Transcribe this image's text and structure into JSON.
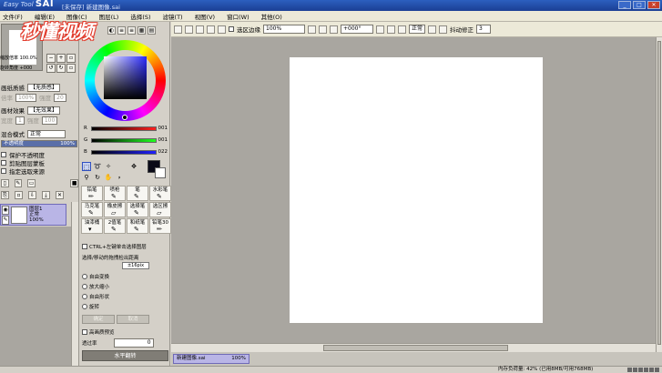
{
  "app": {
    "title_brand": "Easy Tool",
    "title_name": "SAI",
    "document_title": "[未保存] 新建图像.sai",
    "watermark": "秒懂视频"
  },
  "menu": [
    "文件(F)",
    "编辑(E)",
    "图像(C)",
    "图层(L)",
    "选择(S)",
    "滤镜(T)",
    "视图(V)",
    "窗口(W)",
    "其他(O)"
  ],
  "navigator": {
    "zoom_label": "缩放倍率",
    "zoom_value": "100.0%",
    "angle_label": "旋转角度",
    "angle_value": "+000",
    "zoom_minus": "−",
    "zoom_plus": "+",
    "rotate_left": "↺",
    "rotate_right": "↻"
  },
  "layer_props": {
    "paper_texture_label": "画纸质感",
    "paper_texture_value": "【无质感】",
    "texture_scale_label": "倍率",
    "texture_scale_value": "100%",
    "texture_strength_label": "强度",
    "texture_strength_value": "20",
    "paper_effect_label": "画材效果",
    "paper_effect_value": "【无效果】",
    "effect_width_label": "宽度",
    "effect_width_value": "1",
    "effect_strength_label": "强度",
    "effect_strength_value": "100",
    "blend_label": "混合模式",
    "blend_value": "正常",
    "opacity_label": "不透明度",
    "opacity_value": "100%",
    "opacity_fraction": 1.0,
    "options": [
      "保护不透明度",
      "剪贴图层蒙板",
      "指定选取来源"
    ]
  },
  "layers": [
    {
      "name": "图层1",
      "mode": "正常",
      "opacity": "100%"
    }
  ],
  "color": {
    "r_label": "R",
    "r_value": "001",
    "g_label": "G",
    "g_value": "001",
    "b_label": "B",
    "b_value": "022",
    "current": "#0a0a18",
    "hue_accent": "#2a2aff"
  },
  "tools": [
    {
      "label": "铅笔",
      "icon": "pencil-icon"
    },
    {
      "label": "喷枪",
      "icon": "airbrush-icon"
    },
    {
      "label": "笔",
      "icon": "brush-icon"
    },
    {
      "label": "水彩笔",
      "icon": "watercolor-icon"
    },
    {
      "label": "马克笔",
      "icon": "marker-icon"
    },
    {
      "label": "橡皮擦",
      "icon": "eraser-icon"
    },
    {
      "label": "选择笔",
      "icon": "select-pen-icon"
    },
    {
      "label": "选区擦",
      "icon": "select-eraser-icon"
    },
    {
      "label": "油漆桶",
      "icon": "bucket-icon"
    },
    {
      "label": "2值笔",
      "icon": "binary-pen-icon"
    },
    {
      "label": "和纸笔",
      "icon": "washi-pen-icon"
    },
    {
      "label": "铅笔30",
      "icon": "pencil30-icon"
    }
  ],
  "tool_options": {
    "ctrl_option": "CTRL+左键单击选择图层",
    "detect_label": "选择/移动的拖拽检出距离",
    "detect_value": "±16pix",
    "modes": [
      "自由变换",
      "放大缩小",
      "自由形状",
      "旋转"
    ],
    "ok_label": "确定",
    "cancel_label": "取消",
    "hq_preview": "高画质预览",
    "opacity_label": "透过率",
    "opacity_value": "0",
    "flip_label": "水平翻转"
  },
  "canvas_toolbar": {
    "antialias_label": "选区边缘",
    "zoom_value": "100%",
    "angle_value": "+000°",
    "mode_value": "正常",
    "stabilizer_label": "抖动修正",
    "stabilizer_value": "3"
  },
  "document_tab": {
    "name": "新建图像.sai",
    "zoom": "100%"
  },
  "status": {
    "memory": "内存负荷量: 42% (已用8MB/可用768MB)"
  }
}
